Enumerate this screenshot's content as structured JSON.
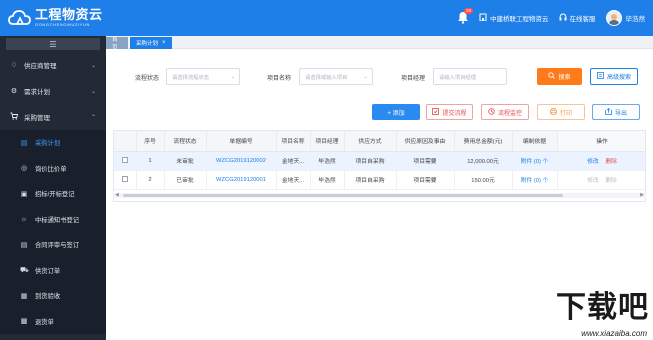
{
  "header": {
    "logo_name": "工程物资云",
    "logo_sub": "GONGCHENGWUZIYUN",
    "notification_count": "28",
    "company": "中建桥联工程物资云",
    "support": "在线客服",
    "user": "毕浩然"
  },
  "sidebar": {
    "toggle": "☰",
    "groups": [
      {
        "label": "供应商管理",
        "icon": "supplier-icon",
        "expanded": false
      },
      {
        "label": "需求计划",
        "icon": "gear-icon",
        "expanded": false
      },
      {
        "label": "采购管理",
        "icon": "cart-icon",
        "expanded": true
      }
    ],
    "items": [
      {
        "label": "采购计划",
        "icon": "plan-icon",
        "active": true
      },
      {
        "label": "询价比价单",
        "icon": "inquiry-icon"
      },
      {
        "label": "招标/开标登记",
        "icon": "bid-icon"
      },
      {
        "label": "中标通知书登记",
        "icon": "award-icon"
      },
      {
        "label": "合同评审与签订",
        "icon": "contract-icon"
      },
      {
        "label": "供货订单",
        "icon": "order-icon"
      },
      {
        "label": "到货验收",
        "icon": "receive-icon"
      },
      {
        "label": "退货单",
        "icon": "return-icon"
      }
    ]
  },
  "tabs": {
    "home": "首页",
    "active": "采购计划",
    "close": "×"
  },
  "filters": {
    "status_label": "流程状态",
    "status_placeholder": "请选择流程状态",
    "project_label": "项目名称",
    "project_placeholder": "请选择或输入项目",
    "manager_label": "项目经理",
    "manager_placeholder": "请输入项目经理",
    "search": "搜索",
    "advanced": "高级搜索"
  },
  "actions": {
    "add": "+ 添加",
    "submit": "提交流程",
    "monitor": "流程监控",
    "print": "打印",
    "export": "导出"
  },
  "table": {
    "columns": [
      "",
      "序号",
      "流程状态",
      "单据编号",
      "项目名称",
      "项目经理",
      "供应方式",
      "供应原因及事由",
      "费用总金额(元)",
      "编制依据",
      "操作"
    ],
    "rows": [
      {
        "index": "1",
        "status": "未审批",
        "code": "WZCG2019120002",
        "project": "金地天...",
        "manager": "毕浩然",
        "supply": "项目自采购",
        "reason": "项目需要",
        "amount": "12,000.00元",
        "basis": "附件 (0) 个",
        "edit": "修改",
        "delete": "删除",
        "selected": true
      },
      {
        "index": "2",
        "status": "已审批",
        "code": "WZCG2019120001",
        "project": "金地天...",
        "manager": "毕浩然",
        "supply": "项目自采购",
        "reason": "项目需要",
        "amount": "150.00元",
        "basis": "附件 (0) 个",
        "edit": "修改",
        "delete": "删除",
        "selected": false
      }
    ]
  },
  "watermark": {
    "main": "下载吧",
    "url": "www.xiazaiba.com"
  },
  "colors": {
    "brand": "#1f7fe8",
    "sidebar": "#232a36",
    "search": "#ff7a18",
    "danger": "#e04c4c"
  }
}
